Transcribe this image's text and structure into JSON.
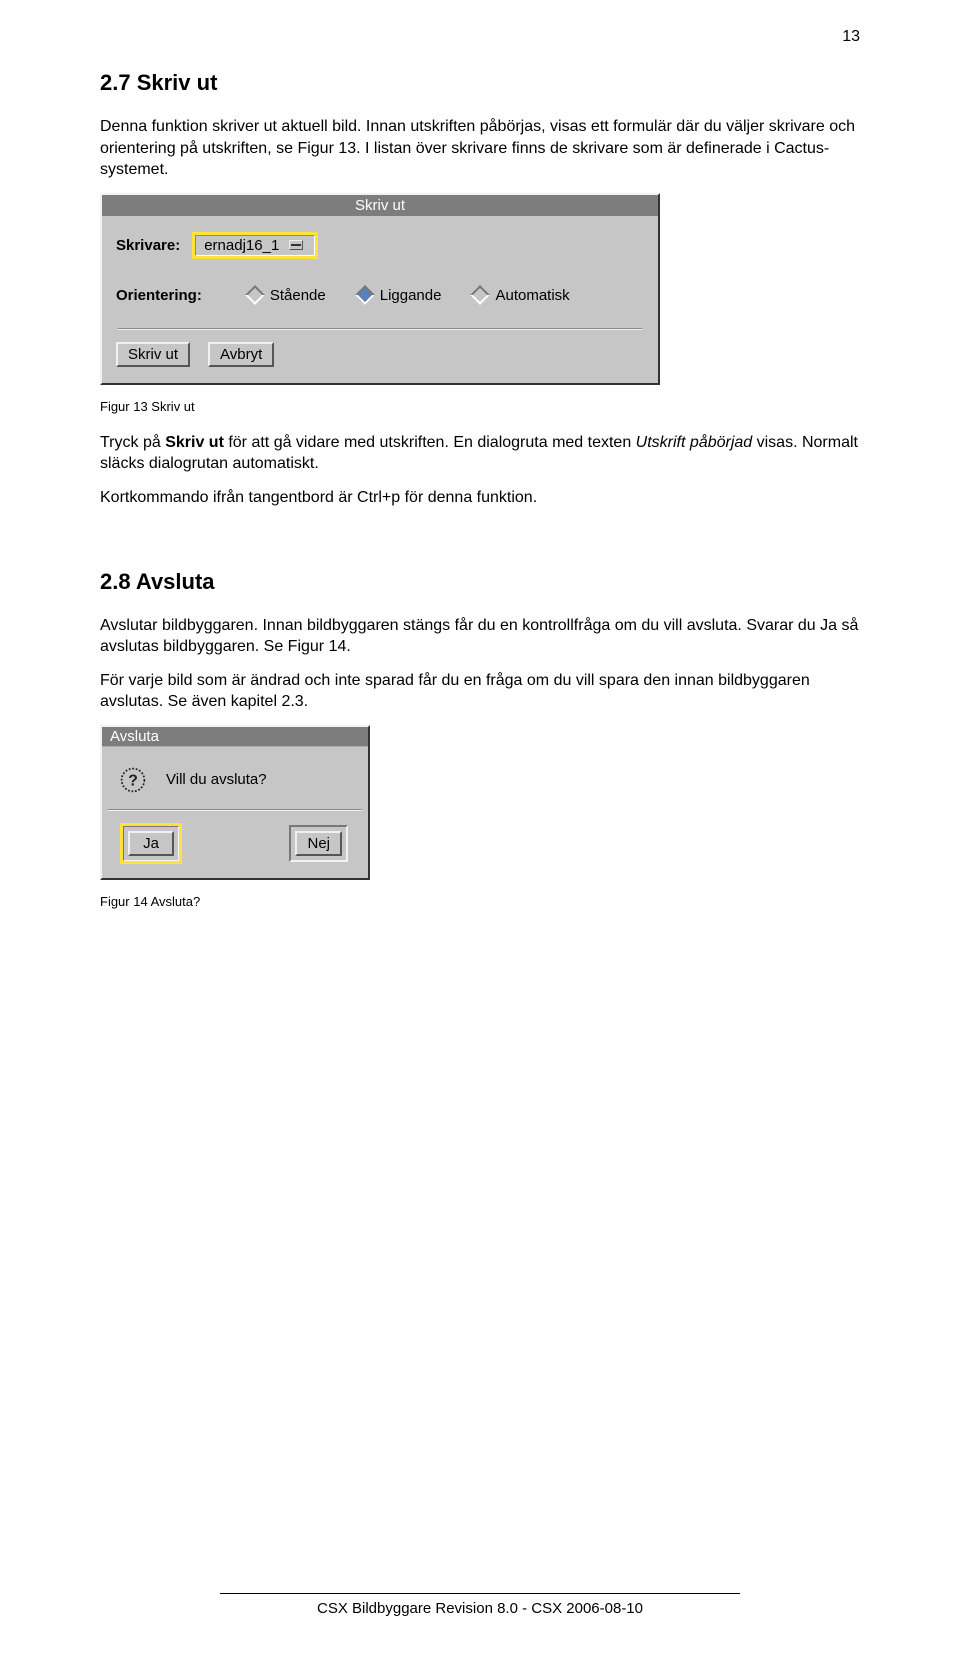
{
  "page_number": "13",
  "section_27": {
    "heading": "2.7  Skriv ut",
    "p1": "Denna funktion skriver ut aktuell bild. Innan utskriften påbörjas, visas ett formulär där du väljer skrivare och orientering på utskriften, se Figur 13. I listan över skrivare finns de skrivare som är definerade i Cactus-systemet.",
    "caption": "Figur 13 Skriv ut",
    "p2_prefix": "Tryck på ",
    "p2_bold": "Skriv ut",
    "p2_mid": " för att gå vidare med utskriften. En dialogruta med texten ",
    "p2_italic": "Utskrift påbörjad",
    "p2_suffix": " visas. Normalt släcks dialogrutan automatiskt.",
    "p3": "Kortkommando ifrån tangentbord är Ctrl+p för denna funktion."
  },
  "dialog_print": {
    "title": "Skriv ut",
    "printer_label": "Skrivare:",
    "printer_value": "ernadj16_1",
    "orientation_label": "Orientering:",
    "opt_standing": "Stående",
    "opt_lying": "Liggande",
    "opt_auto": "Automatisk",
    "selected_option": "Liggande",
    "btn_print": "Skriv ut",
    "btn_cancel": "Avbryt"
  },
  "section_28": {
    "heading": "2.8  Avsluta",
    "p1": "Avslutar bildbyggaren. Innan bildbyggaren stängs får du en kontrollfråga om du vill avsluta. Svarar du Ja så avslutas bildbyggaren. Se Figur 14.",
    "p2": "För varje bild som är ändrad och inte sparad får du en fråga om du vill spara den innan bildbyggaren avslutas. Se även kapitel 2.3.",
    "caption": "Figur 14 Avsluta?"
  },
  "dialog_quit": {
    "title": "Avsluta",
    "question": "Vill du avsluta?",
    "btn_yes": "Ja",
    "btn_no": "Nej"
  },
  "footer": "CSX Bildbyggare Revision 8.0 - CSX 2006-08-10"
}
